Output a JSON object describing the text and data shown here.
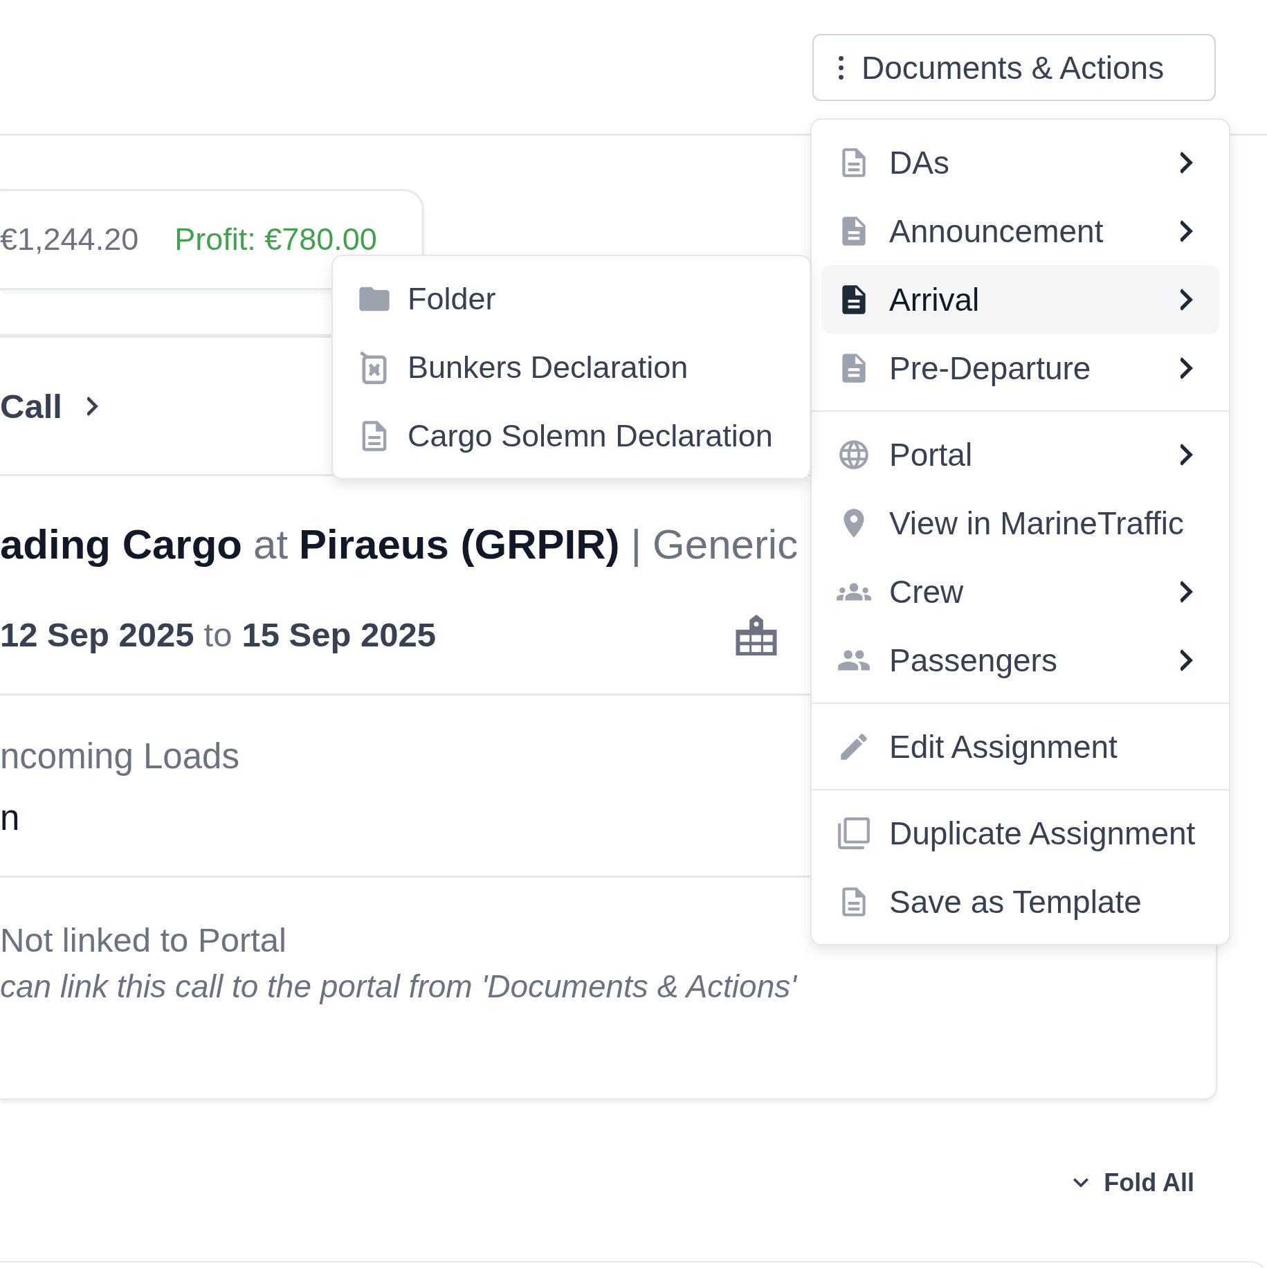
{
  "actions_button": {
    "label": "Documents & Actions"
  },
  "finance": {
    "cost": "€1,244.20",
    "profit": "Profit: €780.00"
  },
  "call_link": {
    "label": "Call"
  },
  "title": [
    {
      "text": "ading Cargo",
      "muted": false
    },
    {
      "text": "at",
      "muted": true
    },
    {
      "text": "Piraeus (GRPIR)",
      "muted": false
    },
    {
      "text": "|",
      "muted": true
    },
    {
      "text": "Generic",
      "muted": true
    }
  ],
  "dates": [
    {
      "text": "12 Sep 2025",
      "muted": false
    },
    {
      "text": "to",
      "muted": true
    },
    {
      "text": "15 Sep 2025",
      "muted": false
    }
  ],
  "loads": {
    "label": "ncoming Loads",
    "value": "n"
  },
  "portal": {
    "status": "Not linked to Portal",
    "hint": "can link this call to the portal from 'Documents & Actions'"
  },
  "fold_all": {
    "label": "Fold All"
  },
  "menu": {
    "groups": [
      [
        {
          "label": "DAs",
          "submenu": true,
          "selected": false
        },
        {
          "label": "Announcement",
          "submenu": true,
          "selected": false
        },
        {
          "label": "Arrival",
          "submenu": true,
          "selected": true
        },
        {
          "label": "Pre-Departure",
          "submenu": true,
          "selected": false
        }
      ],
      [
        {
          "label": "Portal",
          "submenu": true,
          "selected": false
        },
        {
          "label": "View in MarineTraffic",
          "submenu": false,
          "selected": false
        },
        {
          "label": "Crew",
          "submenu": true,
          "selected": false
        },
        {
          "label": "Passengers",
          "submenu": true,
          "selected": false
        }
      ],
      [
        {
          "label": "Edit Assignment",
          "submenu": false,
          "selected": false
        }
      ],
      [
        {
          "label": "Duplicate Assignment",
          "submenu": false,
          "selected": false
        },
        {
          "label": "Save as Template",
          "submenu": false,
          "selected": false
        }
      ]
    ]
  },
  "submenu": {
    "items": [
      {
        "label": "Folder"
      },
      {
        "label": "Bunkers Declaration"
      },
      {
        "label": "Cargo Solemn Declaration"
      }
    ]
  }
}
